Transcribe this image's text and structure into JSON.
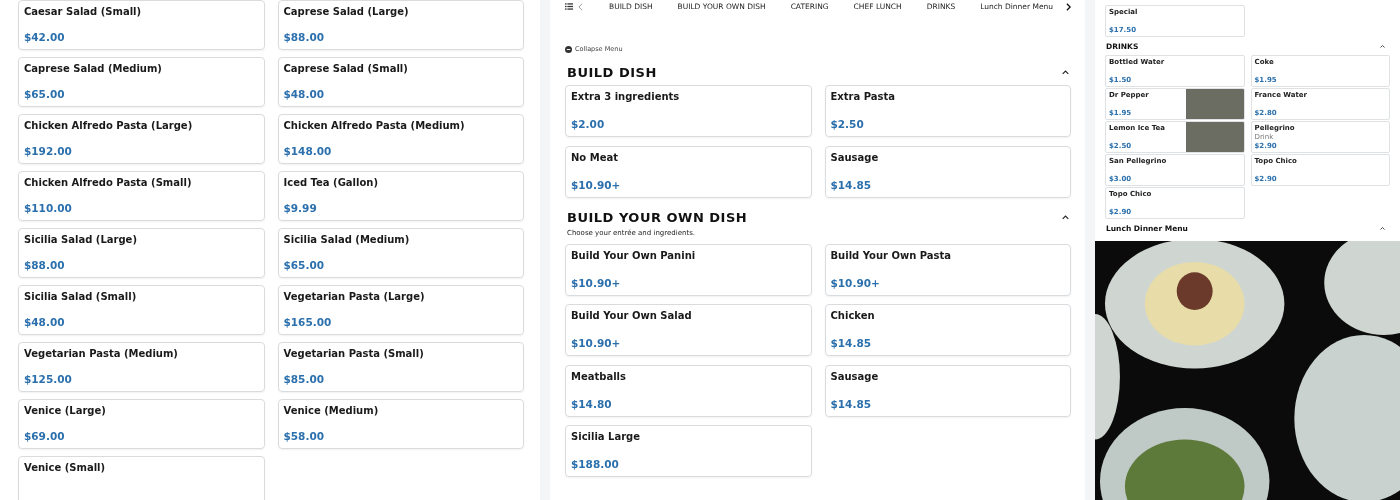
{
  "left_menu": {
    "items": [
      {
        "name": "Caesar Salad (Small)",
        "price": "$42.00"
      },
      {
        "name": "Caprese Salad (Large)",
        "price": "$88.00"
      },
      {
        "name": "Caprese Salad (Medium)",
        "price": "$65.00"
      },
      {
        "name": "Caprese Salad (Small)",
        "price": "$48.00"
      },
      {
        "name": "Chicken Alfredo Pasta (Large)",
        "price": "$192.00"
      },
      {
        "name": "Chicken Alfredo Pasta (Medium)",
        "price": "$148.00"
      },
      {
        "name": "Chicken Alfredo Pasta (Small)",
        "price": "$110.00"
      },
      {
        "name": "Iced Tea (Gallon)",
        "price": "$9.99"
      },
      {
        "name": "Sicilia Salad (Large)",
        "price": "$88.00"
      },
      {
        "name": "Sicilia Salad (Medium)",
        "price": "$65.00"
      },
      {
        "name": "Sicilia Salad (Small)",
        "price": "$48.00"
      },
      {
        "name": "Vegetarian Pasta (Large)",
        "price": "$165.00"
      },
      {
        "name": "Vegetarian Pasta (Medium)",
        "price": "$125.00"
      },
      {
        "name": "Vegetarian Pasta (Small)",
        "price": "$85.00"
      },
      {
        "name": "Venice (Large)",
        "price": "$69.00"
      },
      {
        "name": "Venice (Medium)",
        "price": "$58.00"
      },
      {
        "name": "Venice (Small)"
      }
    ]
  },
  "category_nav": {
    "items": [
      "BUILD DISH",
      "BUILD YOUR OWN DISH",
      "CATERING",
      "CHEF LUNCH",
      "DRINKS",
      "Lunch Dinner Menu"
    ]
  },
  "collapse_label": "Collapse Menu",
  "sections": [
    {
      "title": "BUILD DISH",
      "expanded": true,
      "items": [
        {
          "name": "Extra 3 ingredients",
          "price": "$2.00"
        },
        {
          "name": "Extra Pasta",
          "price": "$2.50"
        },
        {
          "name": "No Meat",
          "price": "$10.90+"
        },
        {
          "name": "Sausage",
          "price": "$14.85"
        }
      ]
    },
    {
      "title": "BUILD YOUR OWN DISH",
      "expanded": true,
      "description": "Choose your entrée and ingredients.",
      "items": [
        {
          "name": "Build Your Own Panini",
          "price": "$10.90+"
        },
        {
          "name": "Build Your Own Pasta",
          "price": "$10.90+"
        },
        {
          "name": "Build Your Own Salad",
          "price": "$10.90+"
        },
        {
          "name": "Chicken",
          "price": "$14.85"
        },
        {
          "name": "Meatballs",
          "price": "$14.80"
        },
        {
          "name": "Sausage",
          "price": "$14.85"
        },
        {
          "name": "Sicilia Large",
          "price": "$188.00"
        }
      ]
    }
  ],
  "side_panel": {
    "top_items": [
      {
        "name": "Special",
        "price": "$17.50"
      }
    ],
    "sections": [
      {
        "title": "DRINKS",
        "expanded": true,
        "items": [
          {
            "name": "Bottled Water",
            "price": "$1.50",
            "has_photo": false
          },
          {
            "name": "Coke",
            "price": "$1.95",
            "has_photo": false
          },
          {
            "name": "Dr Pepper",
            "price": "$1.95",
            "has_photo": true
          },
          {
            "name": "France Water",
            "price": "$2.80",
            "has_photo": false
          },
          {
            "name": "Lemon Ice Tea",
            "price": "$2.50",
            "has_photo": true
          },
          {
            "name": "Pellegrino",
            "description": "Drink",
            "price": "$2.90",
            "has_photo": false
          },
          {
            "name": "San Pellegrino",
            "price": "$3.00",
            "has_photo": false
          },
          {
            "name": "Topo Chico",
            "price": "$2.90",
            "has_photo": false
          },
          {
            "name": "Topo Chico",
            "price": "$2.90",
            "has_photo": false
          }
        ]
      },
      {
        "title": "Lunch Dinner Menu",
        "expanded": true
      }
    ]
  }
}
